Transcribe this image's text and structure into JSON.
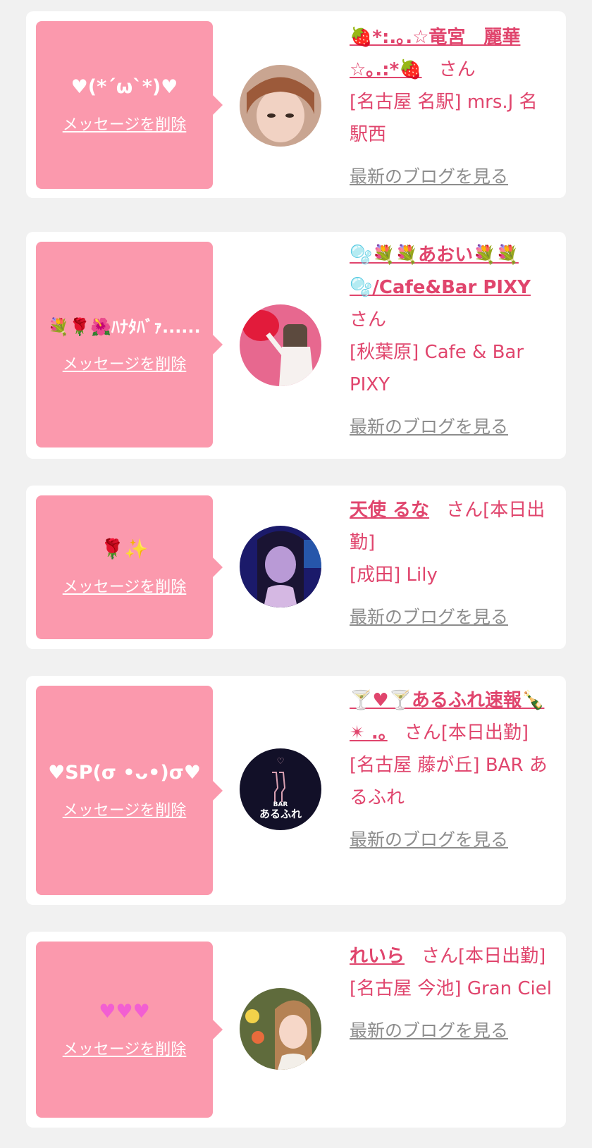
{
  "delete_label": "メッセージを削除",
  "blog_label": "最新のブログを見る",
  "san": "さん",
  "cards": [
    {
      "message": "♥(*´ω`*)♥",
      "name": "🍓*:.｡.☆竜宮　麗華☆｡.:*🍓",
      "suffix": "さん",
      "shop": "[名古屋 名駅] mrs.J 名駅西"
    },
    {
      "message": "💐🌹🌺ﾊﾅﾀﾊﾞｧ......",
      "name": "🫧💐💐あおい💐💐🫧/Cafe&Bar PIXY",
      "suffix": "さん",
      "shop": "[秋葉原] Cafe & Bar PIXY"
    },
    {
      "message": "🌹✨",
      "name": "天使 るな",
      "suffix": "さん[本日出勤]",
      "shop": "[成田] Lily"
    },
    {
      "message": "♥SP(σ •ᴗ•)σ♥",
      "name": "🍸♥🍸あるふれ速報🍾✴ .｡",
      "suffix": "さん[本日出勤]",
      "shop": "[名古屋 藤が丘] BAR あるふれ"
    },
    {
      "message": "♥♥♥",
      "name": "れいら",
      "suffix": "さん[本日出勤]",
      "shop": "[名古屋 今池] Gran Ciel"
    }
  ],
  "avatar_logo": {
    "small": "BAR",
    "big": "あるふれ"
  }
}
